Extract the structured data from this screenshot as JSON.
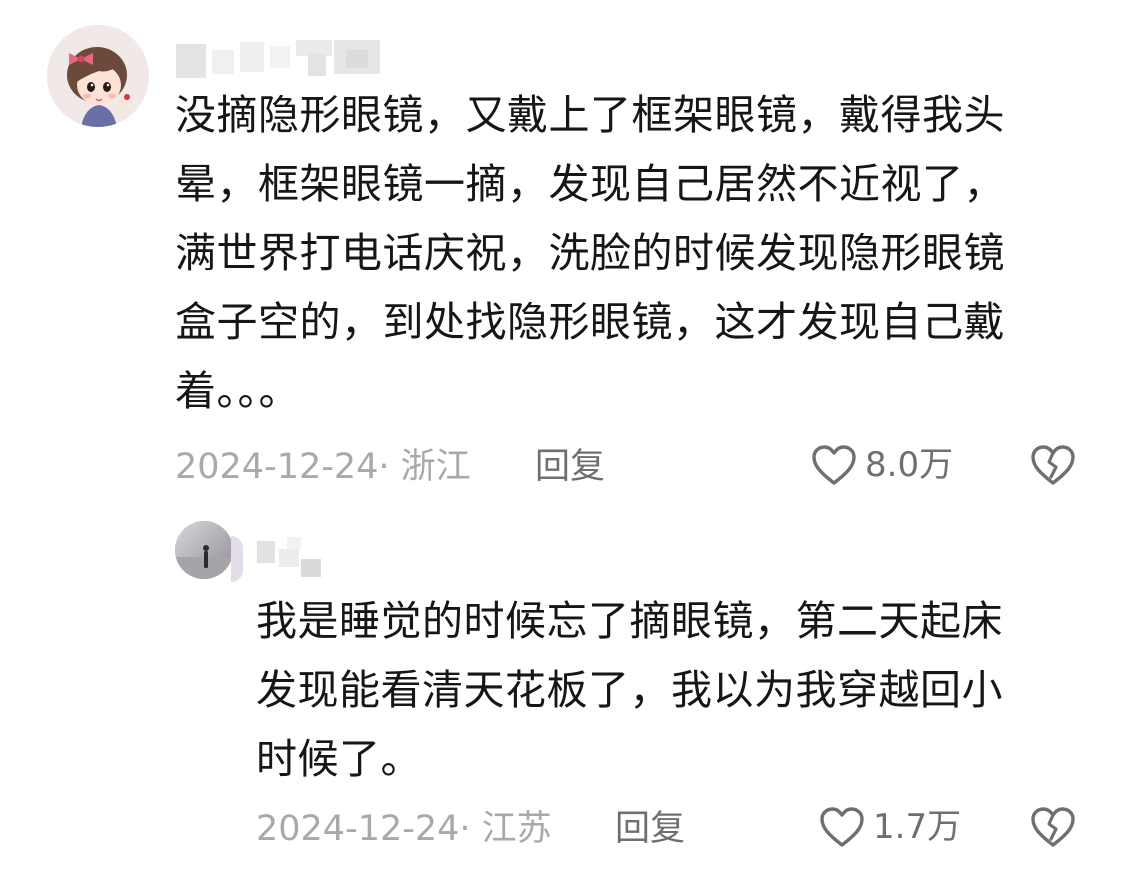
{
  "comment": {
    "text_lines": [
      "没摘隐形眼镜，又戴上了框架眼镜，戴得我头",
      "晕，框架眼镜一摘，发现自己居然不近视了，",
      "满世界打电话庆祝，洗脸的时候发现隐形眼镜",
      "盒子空的，到处找隐形眼镜，这才发现自己戴",
      "着。。。"
    ],
    "meta": "2024-12-24· 浙江",
    "reply_label": "回复",
    "like_count": "8.0万"
  },
  "reply": {
    "text_lines": [
      "我是睡觉的时候忘了摘眼镜，第二天起床",
      "发现能看清天花板了，我以为我穿越回小",
      "时候了。"
    ],
    "meta": "2024-12-24· 江苏",
    "reply_label": "回复",
    "like_count": "1.7万"
  },
  "colors": {
    "text": "#161616",
    "meta": "#a9a9a9",
    "action": "#6f6f6f"
  },
  "icons": {
    "like": "heart-outline-icon",
    "dislike": "broken-heart-icon"
  }
}
